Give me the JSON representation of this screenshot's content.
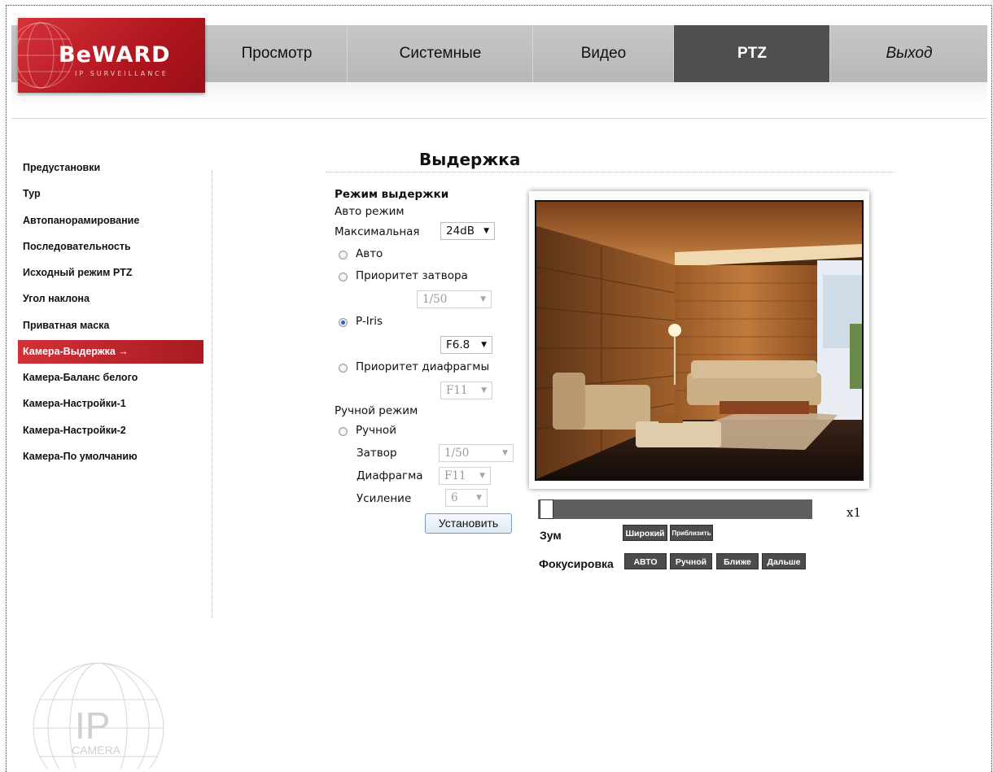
{
  "logo": {
    "brand": "BeWARD",
    "tagline": "IP SURVEILLANCE"
  },
  "nav": {
    "items": [
      {
        "label": "Просмотр"
      },
      {
        "label": "Системные"
      },
      {
        "label": "Видео"
      },
      {
        "label": "PTZ",
        "active": true
      },
      {
        "label": "Выход"
      }
    ]
  },
  "sidebar": {
    "items": [
      {
        "label": "Предустановки"
      },
      {
        "label": "Тур"
      },
      {
        "label": "Автопанорамирование"
      },
      {
        "label": "Последовательность"
      },
      {
        "label": "Исходный режим PTZ"
      },
      {
        "label": "Угол наклона"
      },
      {
        "label": "Приватная маска"
      },
      {
        "label": "Камера-Выдержка →",
        "active": true
      },
      {
        "label": "Камера-Баланс белого"
      },
      {
        "label": "Камера-Настройки-1"
      },
      {
        "label": "Камера-Настройки-2"
      },
      {
        "label": "Камера-По умолчанию"
      }
    ]
  },
  "page": {
    "title": "Выдержка"
  },
  "form": {
    "section_title": "Режим выдержки",
    "auto_mode_label": "Авто режим",
    "max_label": "Максимальная",
    "max_value": "24dB",
    "radio_auto": "Авто",
    "radio_shutter_priority": "Приоритет затвора",
    "shutter_priority_value": "1/50",
    "radio_piris": "P-Iris",
    "piris_value": "F6.8",
    "radio_iris_priority": "Приоритет диафрагмы",
    "iris_priority_value": "F11",
    "manual_mode_label": "Ручной режим",
    "radio_manual": "Ручной",
    "shutter_label": "Затвор",
    "shutter_value": "1/50",
    "iris_label": "Диафрагма",
    "iris_value": "F11",
    "gain_label": "Усиление",
    "gain_value": "6",
    "set_button": "Установить",
    "selected_mode": "P-Iris"
  },
  "ptz": {
    "zoom_level_text": "x1",
    "zoom_slider_fraction": 0.0,
    "zoom_label": "Зум",
    "zoom_wide": "Широкий",
    "zoom_tele": "Приблизить",
    "focus_label": "Фокусировка",
    "focus_auto": "АВТО",
    "focus_manual": "Ручной",
    "focus_near": "Ближе",
    "focus_far": "Дальше"
  },
  "watermark": {
    "line1": "IP",
    "line2": "CAMERA"
  },
  "colors": {
    "brand_red": "#c4222b",
    "nav_active": "#4f4f4f",
    "button_dark": "#4c4c4c"
  }
}
